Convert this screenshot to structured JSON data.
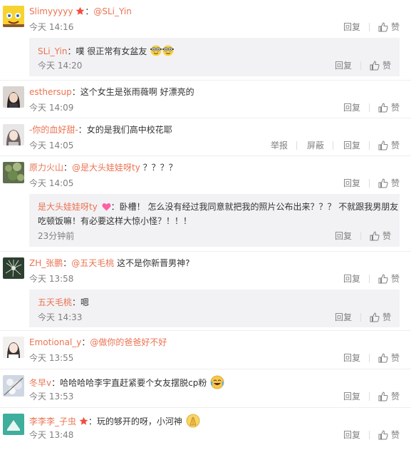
{
  "labels": {
    "reply": "回复",
    "like": "赞",
    "report": "举报",
    "block": "屏蔽"
  },
  "colors": {
    "name": "#eb7350",
    "text": "#333333",
    "meta": "#808080",
    "reply_bg": "#f2f2f5"
  },
  "comments": [
    {
      "user": "Slimyyyyy",
      "avatar": "avatar-sponge",
      "vip": true,
      "mention": "@SLi_Yin",
      "text": "",
      "time": "今天 14:16",
      "reply": {
        "user": "SLi_Yin",
        "text": "噗 很正常有女盆友",
        "emoji": [
          "minion-icon",
          "minion-icon"
        ],
        "time": "今天 14:20"
      }
    },
    {
      "user": "esthersup",
      "avatar": "avatar-girl-dark",
      "text": "这个女生是张雨薇啊 好漂亮的",
      "time": "今天 14:09"
    },
    {
      "user": "-你的血好甜-",
      "avatar": "avatar-girl-light",
      "text": "女的是我们高中校花耶",
      "time": "今天 14:05",
      "report": true
    },
    {
      "user": "原力火山",
      "avatar": "avatar-plants",
      "mention": "@是大头娃娃呀ty",
      "text": " ？？？？",
      "time": "今天 14:05",
      "reply": {
        "user": "是大头娃娃呀ty",
        "heart": true,
        "text": "卧槽！ 怎么没有经过我同意就把我的照片公布出来？？？ 不就跟我男朋友",
        "text2": "吃顿饭嘛！有必要这样大惊小怪？！！！",
        "time": "23分钟前"
      }
    },
    {
      "user": "ZH_张鹏",
      "avatar": "avatar-dandelion",
      "mention": "@五天毛桃",
      "text": " 这不是你新晋男神?",
      "time": "今天 13:58",
      "reply": {
        "user": "五天毛桃",
        "text": "嗯",
        "time": "今天 14:33"
      }
    },
    {
      "user": "Emotional_y",
      "avatar": "avatar-girl-white",
      "mention": "@做你的爸爸好不好",
      "text": "",
      "time": "今天 13:55"
    },
    {
      "user": "冬早v",
      "avatar": "avatar-blossom",
      "text": "哈哈哈哈李宇直赶紧要个女友摆脱cp粉",
      "emoji": [
        "laugh-cry-icon"
      ],
      "time": "今天 13:53"
    },
    {
      "user": "李李李_子虫",
      "avatar": "avatar-teal",
      "vip": true,
      "text": "玩的够开的呀，小河神",
      "emoji": [
        "pray-icon"
      ],
      "time": "今天 13:48"
    }
  ]
}
